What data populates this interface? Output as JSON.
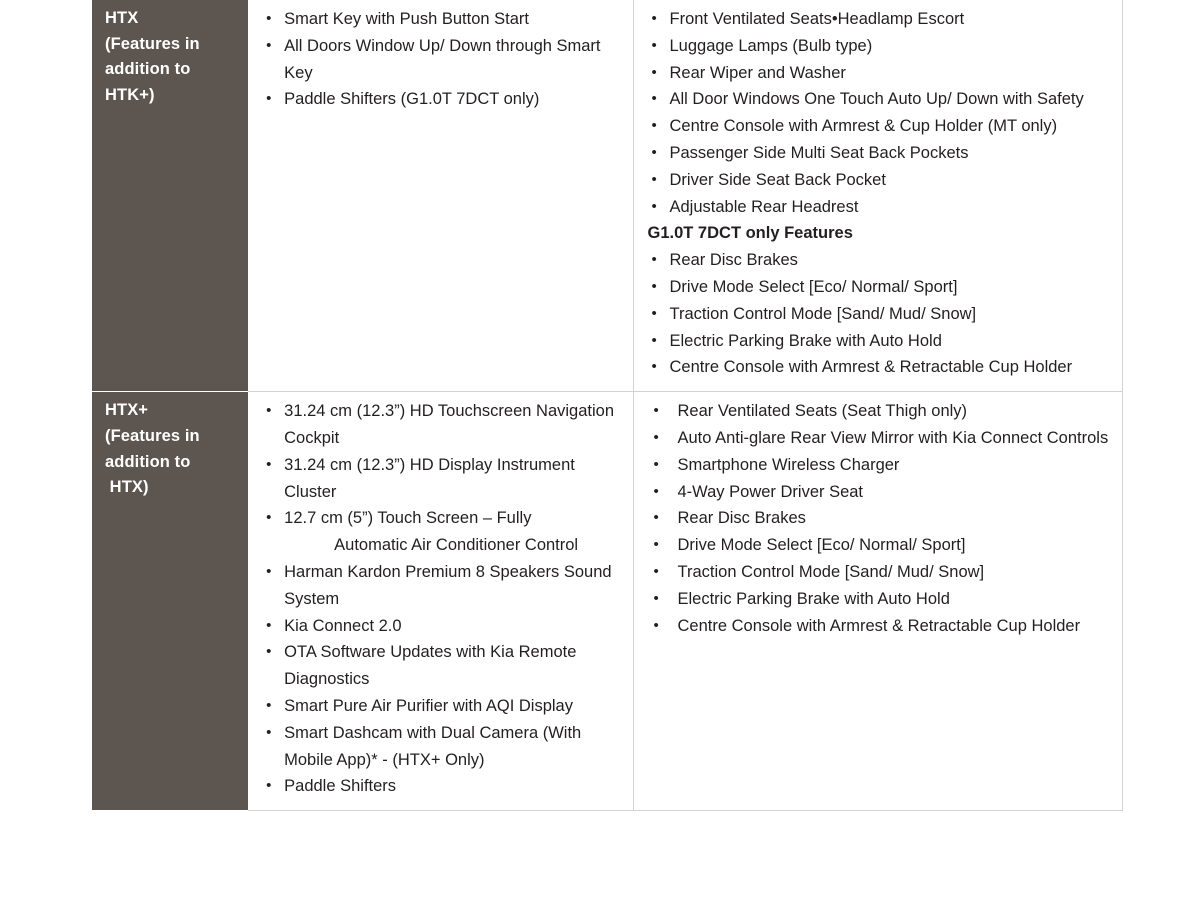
{
  "table": {
    "rows": [
      {
        "variant": {
          "lines": [
            "HTX",
            "(Features in",
            "addition to",
            "HTK+)"
          ]
        },
        "middle_column": {
          "items": [
            {
              "text": "Smart Key with Push Button Start"
            },
            {
              "text": "All Doors Window Up/ Down  through Smart Key"
            },
            {
              "text": "Paddle Shifters (G1.0T 7DCT only)"
            }
          ]
        },
        "right_column": {
          "items": [
            {
              "text": "Front Ventilated Seats",
              "inline_extra": "Headlamp Escort"
            },
            {
              "text": "Luggage Lamps (Bulb type)"
            },
            {
              "text": "Rear Wiper and Washer"
            },
            {
              "text": "All Door Windows One Touch Auto Up/ Down with Safety"
            },
            {
              "text": "Centre Console with Armrest & Cup Holder (MT only)"
            },
            {
              "text": "Passenger Side Multi Seat Back Pockets"
            },
            {
              "text": "Driver Side Seat Back Pocket"
            },
            {
              "text": "Adjustable Rear Headrest"
            },
            {
              "text": "G1.0T 7DCT only Features",
              "style": "heading"
            },
            {
              "text": "Rear Disc Brakes"
            },
            {
              "text": "Drive Mode Select [Eco/ Normal/ Sport]"
            },
            {
              "text": "Traction Control Mode [Sand/ Mud/ Snow]"
            },
            {
              "text": "Electric Parking Brake with Auto Hold"
            },
            {
              "text": "Centre Console with Armrest & Retractable Cup Holder"
            }
          ]
        }
      },
      {
        "variant": {
          "lines": [
            "HTX+",
            "(Features in",
            "addition to",
            " HTX)"
          ]
        },
        "middle_column": {
          "items": [
            {
              "text": "31.24 cm (12.3”) HD Touchscreen Navigation Cockpit"
            },
            {
              "text": "31.24 cm (12.3”) HD Display Instrument Cluster"
            },
            {
              "text": "12.7 cm (5”) Touch Screen – Fully",
              "continuation_indented": "Automatic Air Conditioner Control"
            },
            {
              "text": "Harman Kardon Premium 8 Speakers Sound System"
            },
            {
              "text": "Kia Connect 2.0"
            },
            {
              "text": "OTA Software Updates with Kia Remote Diagnostics"
            },
            {
              "text": "Smart Pure  Air Purifier with AQI Display"
            },
            {
              "text": "Smart Dashcam with Dual Camera (With Mobile App)* - (HTX+ Only)"
            },
            {
              "text": "Paddle Shifters"
            }
          ]
        },
        "right_column": {
          "items": [
            {
              "text": "Rear Ventilated Seats (Seat Thigh only)"
            },
            {
              "text": "Auto Anti-glare Rear View Mirror with Kia Connect Controls"
            },
            {
              "text": "Smartphone Wireless Charger"
            },
            {
              "text": "4-Way Power Driver Seat"
            },
            {
              "text": "Rear Disc Brakes"
            },
            {
              "text": "Drive Mode Select [Eco/ Normal/ Sport]"
            },
            {
              "text": "Traction Control Mode [Sand/ Mud/ Snow]"
            },
            {
              "text": "Electric Parking Brake with Auto Hold"
            },
            {
              "text": "Centre Console with Armrest & Retractable Cup Holder"
            }
          ]
        }
      }
    ]
  },
  "colors": {
    "variant_cell_background": "#5d554f",
    "variant_text": "#ffffff",
    "body_text": "#231f20",
    "border": "#d2d2d2",
    "page_background": "#ffffff"
  }
}
